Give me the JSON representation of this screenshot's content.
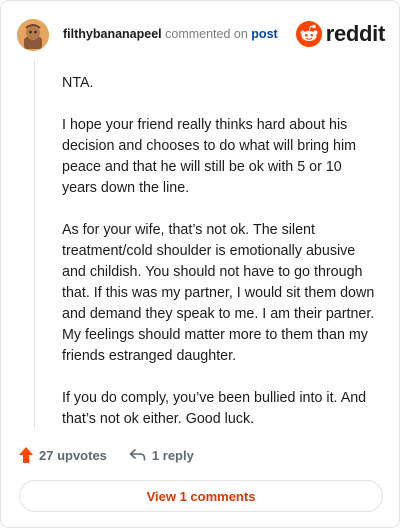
{
  "comment": {
    "username": "filthybananapeel",
    "commented_on_text": "commented on",
    "post_link": "post",
    "paragraphs": [
      "NTA.",
      "I hope your friend really thinks hard about his decision and chooses to do what will bring him peace and that he will still be ok with 5 or 10 years down the line.",
      "As for your wife, that’s not ok. The silent treatment/cold shoulder is emotionally abusive and childish. You should not have to go through that. If this was my partner, I would sit them down and demand they speak to me. I am their partner. My feelings should matter more to them than my friends estranged daughter.",
      "If you do comply, you’ve been bullied into it. And that’s not ok either. Good luck."
    ],
    "upvotes": "27 upvotes",
    "replies": "1 reply",
    "view_comments_label": "View 1 comments"
  },
  "brand": {
    "name": "reddit",
    "color": "#ff4500"
  },
  "colors": {
    "upvote": "#ff4500",
    "link": "#0045ac",
    "view_button_text": "#d93a00"
  },
  "icons": {
    "avatar": "avatar-icon",
    "brand": "reddit-logo-icon",
    "upvote": "upvote-arrow-icon",
    "reply": "reply-arrow-icon"
  }
}
